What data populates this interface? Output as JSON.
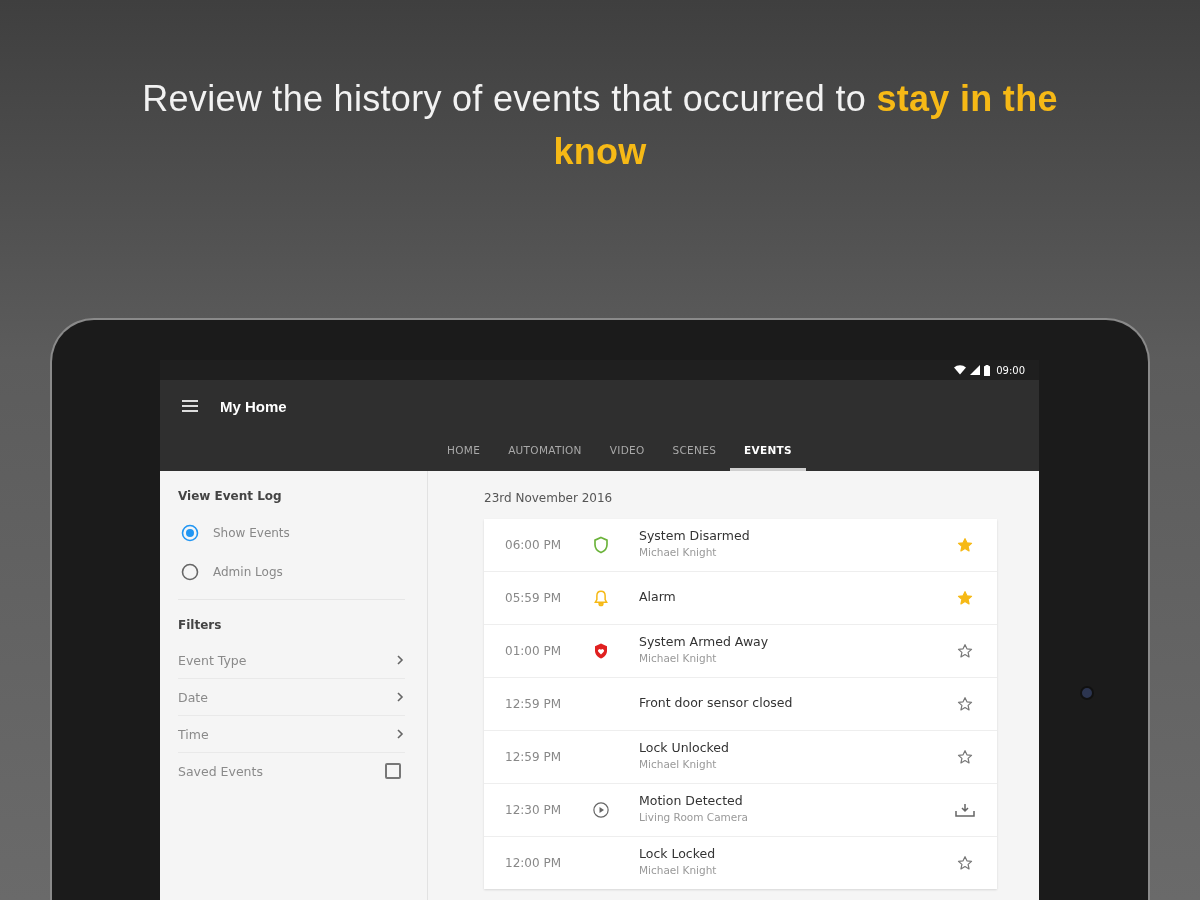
{
  "headline": "Review the history of events that occurred to **stay in the know**",
  "status_bar": {
    "time": "09:00"
  },
  "app_bar": {
    "title": "My Home"
  },
  "tabs": [
    {
      "label": "HOME",
      "selected": false
    },
    {
      "label": "AUTOMATION",
      "selected": false
    },
    {
      "label": "VIDEO",
      "selected": false
    },
    {
      "label": "SCENES",
      "selected": false
    },
    {
      "label": "EVENTS",
      "selected": true
    }
  ],
  "sidebar": {
    "heading": "View Event Log",
    "options": [
      {
        "label": "Show Events",
        "selected": true
      },
      {
        "label": "Admin Logs",
        "selected": false
      }
    ],
    "filters_heading": "Filters",
    "filters": [
      {
        "label": "Event Type",
        "kind": "link"
      },
      {
        "label": "Date",
        "kind": "link"
      },
      {
        "label": "Time",
        "kind": "link"
      },
      {
        "label": "Saved Events",
        "kind": "checkbox",
        "checked": false
      }
    ]
  },
  "date": "23rd November 2016",
  "events": [
    {
      "time": "06:00 PM",
      "kind": "disarmed",
      "title": "System Disarmed",
      "subtitle": "Michael Knight",
      "starred": true
    },
    {
      "time": "05:59 PM",
      "kind": "alarm",
      "title": "Alarm",
      "starred": true
    },
    {
      "time": "01:00 PM",
      "kind": "armed",
      "title": "System Armed Away",
      "subtitle": "Michael Knight",
      "starred": false
    },
    {
      "time": "12:59 PM",
      "kind": "plain",
      "title": "Front door sensor closed",
      "starred": false
    },
    {
      "time": "12:59 PM",
      "kind": "plain",
      "title": "Lock Unlocked",
      "subtitle": "Michael Knight",
      "starred": false
    },
    {
      "time": "12:30 PM",
      "kind": "video",
      "title": "Motion Detected",
      "subtitle": "Living Room Camera"
    },
    {
      "time": "12:00 PM",
      "kind": "plain",
      "title": "Lock Locked",
      "subtitle": "Michael Knight",
      "starred": false
    }
  ]
}
